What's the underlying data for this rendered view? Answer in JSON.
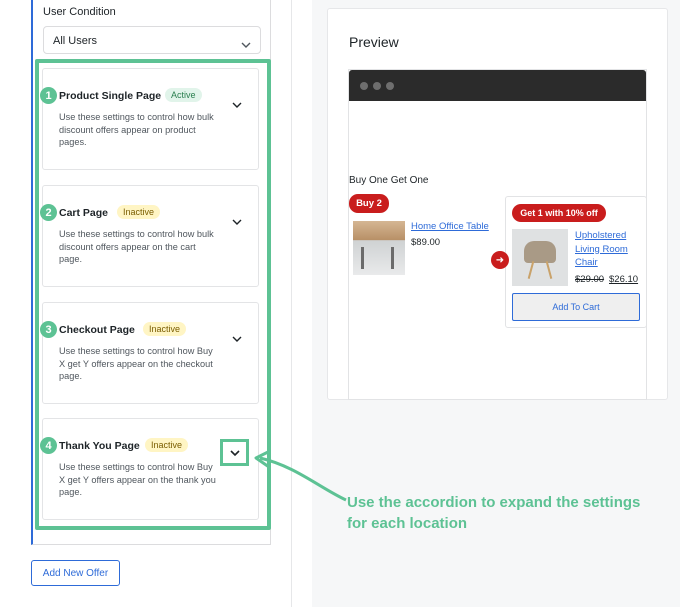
{
  "user_condition": {
    "label": "User Condition",
    "selected": "All Users"
  },
  "sections": [
    {
      "number": "1",
      "title": "Product Single Page",
      "status": "Active",
      "description": "Use these settings to control how bulk discount offers appear on product pages."
    },
    {
      "number": "2",
      "title": "Cart Page",
      "status": "Inactive",
      "description": "Use these settings to control how bulk discount offers appear on the cart page."
    },
    {
      "number": "3",
      "title": "Checkout Page",
      "status": "Inactive",
      "description": "Use these settings to control how Buy X get Y offers appear on the checkout page."
    },
    {
      "number": "4",
      "title": "Thank You Page",
      "status": "Inactive",
      "description": "Use these settings to control how Buy X get Y offers appear on the thank you page."
    }
  ],
  "add_offer_label": "Add New Offer",
  "preview": {
    "title": "Preview",
    "offer_label": "Buy One Get One",
    "buy_badge": "Buy 2",
    "product1": {
      "name": "Home Office Table",
      "price": "$89.00"
    },
    "get_badge": "Get 1 with 10% off",
    "product2": {
      "name": "Upholstered Living Room Chair",
      "old_price": "$29.00",
      "new_price": "$26.10"
    },
    "add_to_cart": "Add To Cart"
  },
  "callout": "Use the accordion to expand the settings for each location",
  "colors": {
    "accent_green": "#5dc294",
    "primary_blue": "#2e6bd8",
    "badge_red": "#c91d1d"
  }
}
